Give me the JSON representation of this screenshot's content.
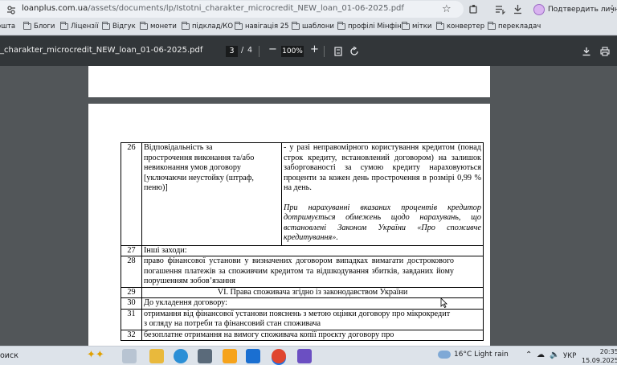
{
  "browser": {
    "url_host": "loanplus.com.ua",
    "url_path": "/assets/documents/lp/Istotni_charakter_microcredit_NEW_loan_01-06-2025.pdf",
    "profile_label": "Подтвердить личность",
    "bookmarks": [
      "ошта",
      "Блоги",
      "Ліцензії",
      "Відгук",
      "монети",
      "підклад/КО",
      "навігація 25",
      "шаблони",
      "профілі Мінфін",
      "мітки",
      "конвертер",
      "перекладач"
    ]
  },
  "pdf": {
    "title": "_charakter_microcredit_NEW_loan_01-06-2025.pdf",
    "current_page": "3",
    "page_separator": "/",
    "total_pages": "4",
    "zoom": "100%",
    "zoom_out": "−",
    "zoom_in": "+"
  },
  "table": {
    "r26": {
      "num": "26",
      "left_lines": [
        "Відповідальність за",
        "прострочення виконання та/або",
        "невиконання умов договору",
        "[уключаючи неустойку (штраф,",
        "пеню)]"
      ],
      "right_text": "-  у разі неправомірного користування кредитом (понад строк кредиту, встановлений договором) на залишок заборгованості за сумою кредиту нараховуються проценти за кожен день прострочення в розмірі 0,99 % на день.",
      "right_italic": "При нарахуванні вказаних процентів кредитор дотримується обмежень щодо нарахувань, що встановлені Законом України «Про споживче кредитування»."
    },
    "r27": {
      "num": "27",
      "text": "Інші заходи:"
    },
    "r28": {
      "num": "28",
      "text": "право фінансової установи    у визначених договором випадках вимагати дострокового погашення платежів за споживчим кредитом та відшкодування збитків, завданих йому порушенням зобов’язання"
    },
    "r29": {
      "num": "29",
      "text": "VI. Права споживача згідно із законодавством України"
    },
    "r30": {
      "num": "30",
      "text": "До укладення договору:"
    },
    "r31": {
      "num": "31",
      "text": "отримання від фінансової установи пояснень з метою оцінки договору про мікрокредит з огляду на потреби та фінансовий стан споживача"
    },
    "r32": {
      "num": "32",
      "text": "безоплатне отримання на вимогу споживача копії проєкту договору про"
    }
  },
  "taskbar": {
    "search_text": "оиск",
    "weather": "16°C  Light rain",
    "lang": "УКР",
    "time": "20:35",
    "date": "15.09.2025"
  }
}
